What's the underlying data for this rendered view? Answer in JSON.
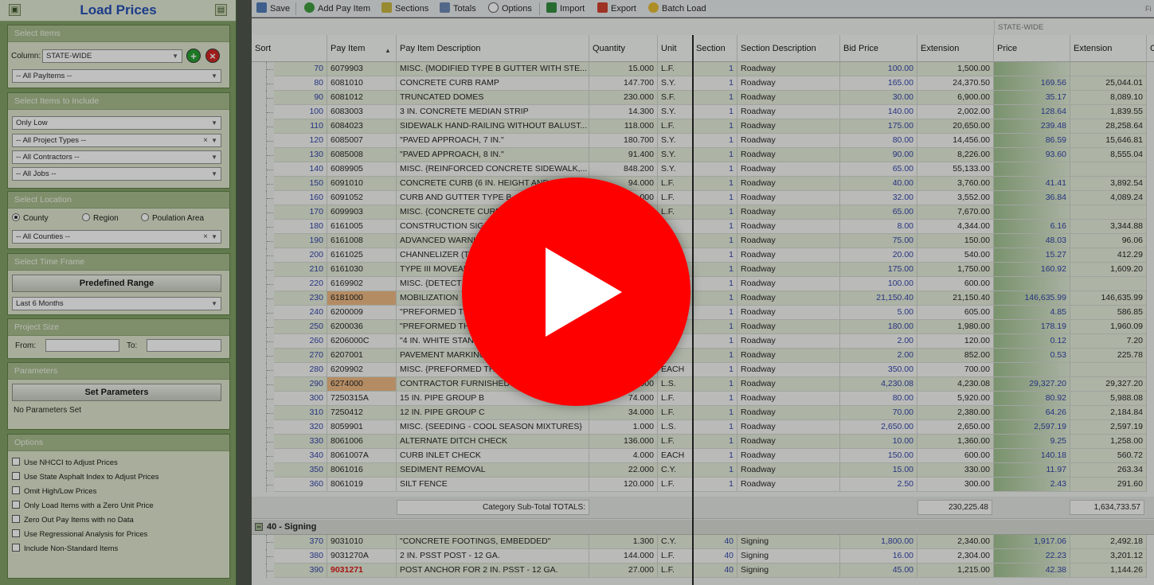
{
  "sidebar": {
    "title": "Load Prices",
    "select_items": {
      "heading": "Select Items",
      "column_label": "Column:",
      "column_value": "STATE-WIDE",
      "payitems_value": "-- All PayItems --"
    },
    "include": {
      "heading": "Select Items to Include",
      "only_low": "Only Low",
      "project_types": "-- All Project Types --",
      "contractors": "-- All Contractors --",
      "jobs": "-- All Jobs --"
    },
    "location": {
      "heading": "Select Location",
      "county": "County",
      "region": "Region",
      "population": "Poulation Area",
      "counties": "-- All Counties --",
      "selected": "County"
    },
    "timeframe": {
      "heading": "Select Time Frame",
      "predefined_button": "Predefined Range",
      "range_value": "Last 6 Months"
    },
    "project_size": {
      "heading": "Project Size",
      "from_label": "From:",
      "to_label": "To:"
    },
    "parameters": {
      "heading": "Parameters",
      "set_button": "Set Parameters",
      "status": "No Parameters Set"
    },
    "options": {
      "heading": "Options",
      "items": [
        "Use NHCCI to Adjust Prices",
        "Use State Asphalt Index to Adjust Prices",
        "Omit High/Low Prices",
        "Only Load Items with a Zero Unit  Price",
        "Zero Out Pay Items with no Data",
        "Use Regressional Analysis for Prices",
        "Include Non-Standard Items"
      ]
    }
  },
  "toolbar": {
    "save": "Save",
    "add_pay_item": "Add Pay Item",
    "sections": "Sections",
    "totals": "Totals",
    "options": "Options",
    "import": "Import",
    "export": "Export",
    "batch_load": "Batch Load",
    "right_text": "Fi"
  },
  "grid": {
    "group_header": "STATE-WIDE",
    "columns": [
      "Sort",
      "Pay Item",
      "Pay Item Description",
      "Quantity",
      "Unit",
      "Section",
      "Section Description",
      "Bid Price",
      "Extension",
      "Price",
      "Extension",
      "C"
    ],
    "rows": [
      {
        "sort": "70",
        "item": "6079903",
        "desc": "MISC. {MODIFIED TYPE B GUTTER WITH STE...",
        "qty": "15.000",
        "unit": "L.F.",
        "section": "1",
        "secdesc": "Roadway",
        "bid": "100.00",
        "ext": "1,500.00",
        "price": "",
        "pext": ""
      },
      {
        "sort": "80",
        "item": "6081010",
        "desc": "CONCRETE CURB RAMP",
        "qty": "147.700",
        "unit": "S.Y.",
        "section": "1",
        "secdesc": "Roadway",
        "bid": "165.00",
        "ext": "24,370.50",
        "price": "169.56",
        "pext": "25,044.01"
      },
      {
        "sort": "90",
        "item": "6081012",
        "desc": "TRUNCATED DOMES",
        "qty": "230.000",
        "unit": "S.F.",
        "section": "1",
        "secdesc": "Roadway",
        "bid": "30.00",
        "ext": "6,900.00",
        "price": "35.17",
        "pext": "8,089.10"
      },
      {
        "sort": "100",
        "item": "6083003",
        "desc": "3 IN. CONCRETE MEDIAN STRIP",
        "qty": "14.300",
        "unit": "S.Y.",
        "section": "1",
        "secdesc": "Roadway",
        "bid": "140.00",
        "ext": "2,002.00",
        "price": "128.64",
        "pext": "1,839.55"
      },
      {
        "sort": "110",
        "item": "6084023",
        "desc": "SIDEWALK HAND-RAILING WITHOUT BALUST...",
        "qty": "118.000",
        "unit": "L.F.",
        "section": "1",
        "secdesc": "Roadway",
        "bid": "175.00",
        "ext": "20,650.00",
        "price": "239.48",
        "pext": "28,258.64"
      },
      {
        "sort": "120",
        "item": "6085007",
        "desc": "\"PAVED APPROACH, 7 IN.\"",
        "qty": "180.700",
        "unit": "S.Y.",
        "section": "1",
        "secdesc": "Roadway",
        "bid": "80.00",
        "ext": "14,456.00",
        "price": "86.59",
        "pext": "15,646.81"
      },
      {
        "sort": "130",
        "item": "6085008",
        "desc": "\"PAVED APPROACH, 8 IN.\"",
        "qty": "91.400",
        "unit": "S.Y.",
        "section": "1",
        "secdesc": "Roadway",
        "bid": "90.00",
        "ext": "8,226.00",
        "price": "93.60",
        "pext": "8,555.04"
      },
      {
        "sort": "140",
        "item": "6089905",
        "desc": "MISC. {REINFORCED CONCRETE SIDEWALK,...",
        "qty": "848.200",
        "unit": "S.Y.",
        "section": "1",
        "secdesc": "Roadway",
        "bid": "65.00",
        "ext": "55,133.00",
        "price": "",
        "pext": ""
      },
      {
        "sort": "150",
        "item": "6091010",
        "desc": "CONCRETE CURB (6 IN. HEIGHT AND",
        "qty": "94.000",
        "unit": "L.F.",
        "section": "1",
        "secdesc": "Roadway",
        "bid": "40.00",
        "ext": "3,760.00",
        "price": "41.41",
        "pext": "3,892.54"
      },
      {
        "sort": "160",
        "item": "6091052",
        "desc": "CURB AND GUTTER TYPE B",
        "qty": "000",
        "unit": "L.F.",
        "section": "1",
        "secdesc": "Roadway",
        "bid": "32.00",
        "ext": "3,552.00",
        "price": "36.84",
        "pext": "4,089.24"
      },
      {
        "sort": "170",
        "item": "6099903",
        "desc": "MISC. {CONCRETE CURB",
        "qty": "",
        "unit": "L.F.",
        "section": "1",
        "secdesc": "Roadway",
        "bid": "65.00",
        "ext": "7,670.00",
        "price": "",
        "pext": ""
      },
      {
        "sort": "180",
        "item": "6161005",
        "desc": "CONSTRUCTION SIGN",
        "qty": "",
        "unit": "F.",
        "section": "1",
        "secdesc": "Roadway",
        "bid": "8.00",
        "ext": "4,344.00",
        "price": "6.16",
        "pext": "3,344.88"
      },
      {
        "sort": "190",
        "item": "6161008",
        "desc": "ADVANCED WARNI",
        "qty": "",
        "unit": "H",
        "section": "1",
        "secdesc": "Roadway",
        "bid": "75.00",
        "ext": "150.00",
        "price": "48.03",
        "pext": "96.06"
      },
      {
        "sort": "200",
        "item": "6161025",
        "desc": "CHANNELIZER (T",
        "qty": "",
        "unit": "",
        "section": "1",
        "secdesc": "Roadway",
        "bid": "20.00",
        "ext": "540.00",
        "price": "15.27",
        "pext": "412.29"
      },
      {
        "sort": "210",
        "item": "6161030",
        "desc": "TYPE III MOVEAB",
        "qty": "",
        "unit": "",
        "section": "1",
        "secdesc": "Roadway",
        "bid": "175.00",
        "ext": "1,750.00",
        "price": "160.92",
        "pext": "1,609.20"
      },
      {
        "sort": "220",
        "item": "6169902",
        "desc": "MISC. {DETECT",
        "qty": "",
        "unit": "",
        "section": "1",
        "secdesc": "Roadway",
        "bid": "100.00",
        "ext": "600.00",
        "price": "",
        "pext": ""
      },
      {
        "sort": "230",
        "item": "6181000",
        "desc": "MOBILIZATION",
        "qty": "",
        "unit": "",
        "section": "1",
        "secdesc": "Roadway",
        "bid": "21,150.40",
        "ext": "21,150.40",
        "price": "146,635.99",
        "pext": "146,635.99",
        "hl": true
      },
      {
        "sort": "240",
        "item": "6200009",
        "desc": "\"PREFORMED TH",
        "qty": "",
        "unit": "",
        "section": "1",
        "secdesc": "Roadway",
        "bid": "5.00",
        "ext": "605.00",
        "price": "4.85",
        "pext": "586.85"
      },
      {
        "sort": "250",
        "item": "6200036",
        "desc": "\"PREFORMED TH",
        "qty": "",
        "unit": "",
        "section": "1",
        "secdesc": "Roadway",
        "bid": "180.00",
        "ext": "1,980.00",
        "price": "178.19",
        "pext": "1,960.09"
      },
      {
        "sort": "260",
        "item": "6206000C",
        "desc": "\"4 IN. WHITE STAN",
        "qty": "",
        "unit": "",
        "section": "1",
        "secdesc": "Roadway",
        "bid": "2.00",
        "ext": "120.00",
        "price": "0.12",
        "pext": "7.20"
      },
      {
        "sort": "270",
        "item": "6207001",
        "desc": "PAVEMENT MARKING",
        "qty": "",
        "unit": "F.",
        "section": "1",
        "secdesc": "Roadway",
        "bid": "2.00",
        "ext": "852.00",
        "price": "0.53",
        "pext": "225.78"
      },
      {
        "sort": "280",
        "item": "6209902",
        "desc": "MISC. {PREFORMED THE",
        "qty": "",
        "unit": "EACH",
        "section": "1",
        "secdesc": "Roadway",
        "bid": "350.00",
        "ext": "700.00",
        "price": "",
        "pext": ""
      },
      {
        "sort": "290",
        "item": "6274000",
        "desc": "CONTRACTOR FURNISHED S",
        "qty": "000",
        "unit": "L.S.",
        "section": "1",
        "secdesc": "Roadway",
        "bid": "4,230.08",
        "ext": "4,230.08",
        "price": "29,327.20",
        "pext": "29,327.20",
        "hl": true
      },
      {
        "sort": "300",
        "item": "7250315A",
        "desc": "15 IN. PIPE GROUP B",
        "qty": "74.000",
        "unit": "L.F.",
        "section": "1",
        "secdesc": "Roadway",
        "bid": "80.00",
        "ext": "5,920.00",
        "price": "80.92",
        "pext": "5,988.08"
      },
      {
        "sort": "310",
        "item": "7250412",
        "desc": "12 IN. PIPE GROUP C",
        "qty": "34.000",
        "unit": "L.F.",
        "section": "1",
        "secdesc": "Roadway",
        "bid": "70.00",
        "ext": "2,380.00",
        "price": "64.26",
        "pext": "2,184.84"
      },
      {
        "sort": "320",
        "item": "8059901",
        "desc": "MISC. {SEEDING - COOL SEASON MIXTURES}",
        "qty": "1.000",
        "unit": "L.S.",
        "section": "1",
        "secdesc": "Roadway",
        "bid": "2,650.00",
        "ext": "2,650.00",
        "price": "2,597.19",
        "pext": "2,597.19"
      },
      {
        "sort": "330",
        "item": "8061006",
        "desc": "ALTERNATE DITCH CHECK",
        "qty": "136.000",
        "unit": "L.F.",
        "section": "1",
        "secdesc": "Roadway",
        "bid": "10.00",
        "ext": "1,360.00",
        "price": "9.25",
        "pext": "1,258.00"
      },
      {
        "sort": "340",
        "item": "8061007A",
        "desc": "CURB INLET CHECK",
        "qty": "4.000",
        "unit": "EACH",
        "section": "1",
        "secdesc": "Roadway",
        "bid": "150.00",
        "ext": "600.00",
        "price": "140.18",
        "pext": "560.72"
      },
      {
        "sort": "350",
        "item": "8061016",
        "desc": "SEDIMENT REMOVAL",
        "qty": "22.000",
        "unit": "C.Y.",
        "section": "1",
        "secdesc": "Roadway",
        "bid": "15.00",
        "ext": "330.00",
        "price": "11.97",
        "pext": "263.34"
      },
      {
        "sort": "360",
        "item": "8061019",
        "desc": "SILT FENCE",
        "qty": "120.000",
        "unit": "L.F.",
        "section": "1",
        "secdesc": "Roadway",
        "bid": "2.50",
        "ext": "300.00",
        "price": "2.43",
        "pext": "291.60"
      }
    ],
    "subtotal": {
      "label": "Category Sub-Total TOTALS:",
      "ext": "230,225.48",
      "pext": "1,634,733.57"
    },
    "signing_header": "40 - Signing",
    "signing_rows": [
      {
        "sort": "370",
        "item": "9031010",
        "desc": "\"CONCRETE FOOTINGS, EMBEDDED\"",
        "qty": "1.300",
        "unit": "C.Y.",
        "section": "40",
        "secdesc": "Signing",
        "bid": "1,800.00",
        "ext": "2,340.00",
        "price": "1,917.06",
        "pext": "2,492.18"
      },
      {
        "sort": "380",
        "item": "9031270A",
        "desc": "2 IN. PSST POST - 12 GA.",
        "qty": "144.000",
        "unit": "L.F.",
        "section": "40",
        "secdesc": "Signing",
        "bid": "16.00",
        "ext": "2,304.00",
        "price": "22.23",
        "pext": "3,201.12"
      },
      {
        "sort": "390",
        "item": "9031271",
        "desc": "POST ANCHOR FOR 2 IN. PSST - 12 GA.",
        "qty": "27.000",
        "unit": "L.F.",
        "section": "40",
        "secdesc": "Signing",
        "bid": "45.00",
        "ext": "1,215.00",
        "price": "42.38",
        "pext": "1,144.26",
        "red": true
      }
    ]
  },
  "colors": {
    "panel": "#7f9e62",
    "accent": "#1d49b4",
    "play": "#ff0000",
    "highlight": "#f0b882"
  },
  "icons": {
    "play": "play-icon",
    "save": "save-icon",
    "add": "add-icon",
    "remove": "remove-icon"
  }
}
